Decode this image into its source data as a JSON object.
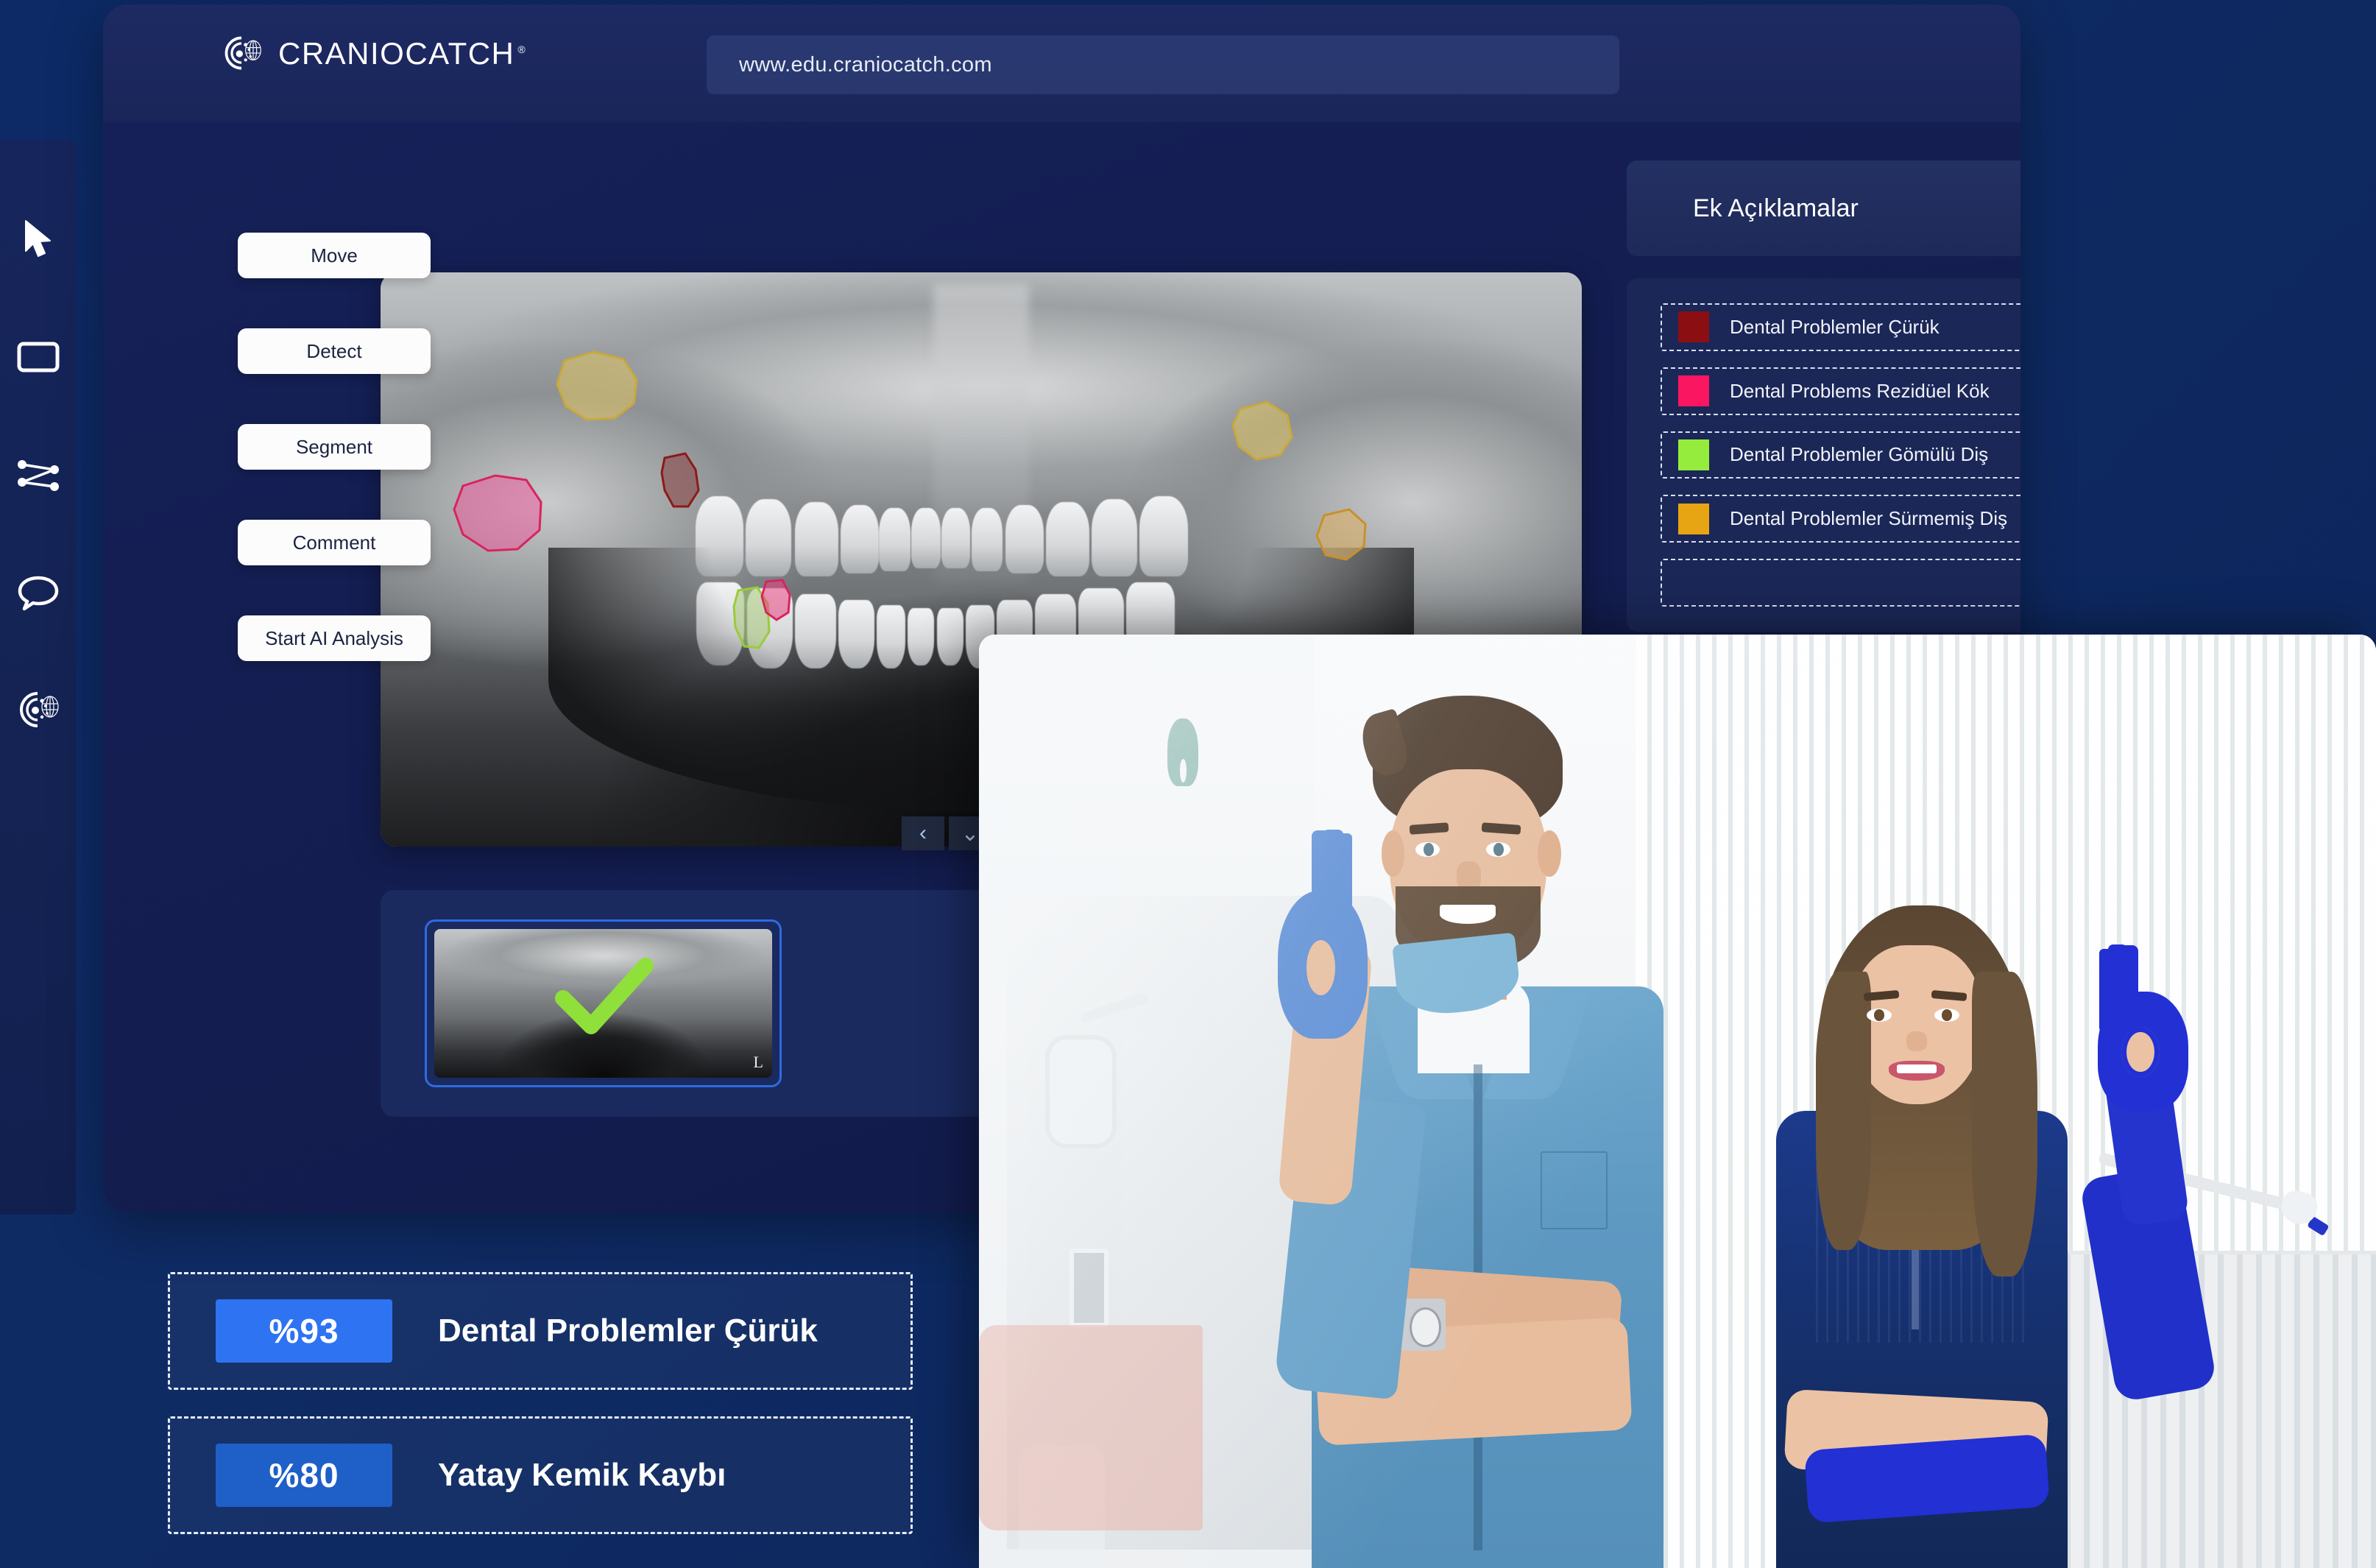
{
  "header": {
    "brand_name": "CRANIOCATCH",
    "brand_reg": "®",
    "brand_mark_icon": "craniocatch-logo-icon",
    "url": "www.edu.craniocatch.com"
  },
  "icon_rail": {
    "items": [
      {
        "name": "cursor-icon",
        "label": "Select"
      },
      {
        "name": "rectangle-icon",
        "label": "Rectangle"
      },
      {
        "name": "polyline-icon",
        "label": "Polyline"
      },
      {
        "name": "comment-bubble-icon",
        "label": "Comment"
      },
      {
        "name": "craniocatch-logo-icon",
        "label": "CranioCatch"
      }
    ]
  },
  "tools": {
    "buttons": [
      {
        "label": "Move"
      },
      {
        "label": "Detect"
      },
      {
        "label": "Segment"
      },
      {
        "label": "Comment"
      },
      {
        "label": "Start AI Analysis"
      }
    ]
  },
  "viewer": {
    "nav": {
      "prev_icon": "chevron-left-icon",
      "down_icon": "chevron-down-icon",
      "next_icon": "chevron-right-icon",
      "prev_label": "‹",
      "down_label": "⌄",
      "next_label": "›"
    },
    "annotations": [
      {
        "name": "impacted-tooth-upper-left",
        "color": "#E0C463",
        "shape": "blob"
      },
      {
        "name": "residual-root-left",
        "color": "#F0569B",
        "shape": "circle"
      },
      {
        "name": "caries-upper-left",
        "color": "#8B4A4A",
        "shape": "polygon"
      },
      {
        "name": "unerupted-tooth-lower",
        "color": "#A8C97A",
        "shape": "polygon"
      },
      {
        "name": "residual-root-lower",
        "color": "#E8427F",
        "shape": "polygon"
      },
      {
        "name": "impacted-tooth-upper-right",
        "color": "#E0C463",
        "shape": "blob"
      },
      {
        "name": "caries-right",
        "color": "#E0B060",
        "shape": "blob"
      }
    ]
  },
  "thumbnails": {
    "selected_index": 0,
    "items": [
      {
        "name": "panoramic-xray-thumbnail",
        "orientation_marker": "L",
        "status_icon": "green-check-icon",
        "selected": true
      }
    ]
  },
  "annotations_panel": {
    "title": "Ek Açıklamalar",
    "items": [
      {
        "label": "Dental Problemler Çürük",
        "color": "#8B0F12"
      },
      {
        "label": "Dental Problems Rezidüel Kök",
        "color": "#FB1661"
      },
      {
        "label": "Dental Problemler Gömülü Diş",
        "color": "#95EC3C"
      },
      {
        "label": "Dental Problemler Sürmemiş Diş",
        "color": "#E8A513"
      },
      {
        "label": "",
        "color": "#1B2757"
      }
    ]
  },
  "results": {
    "rows": [
      {
        "percent": "%93",
        "label": "Dental Problemler Çürük",
        "badge_color": "#2E73F2"
      },
      {
        "percent": "%80",
        "label": "Yatay Kemik Kaybı",
        "badge_color": "#1F5FC8"
      }
    ]
  },
  "photo": {
    "name": "dental-team-photo",
    "alt": "Two dental professionals making OK hand gestures in a clinic"
  },
  "colors": {
    "page_background": "#0E2A63",
    "window_background": "#141E52",
    "header_background": "#1D2A63",
    "panel_background": "#1B2757",
    "accent_blue": "#2E73F2",
    "selected_border": "#2E6BE0"
  }
}
